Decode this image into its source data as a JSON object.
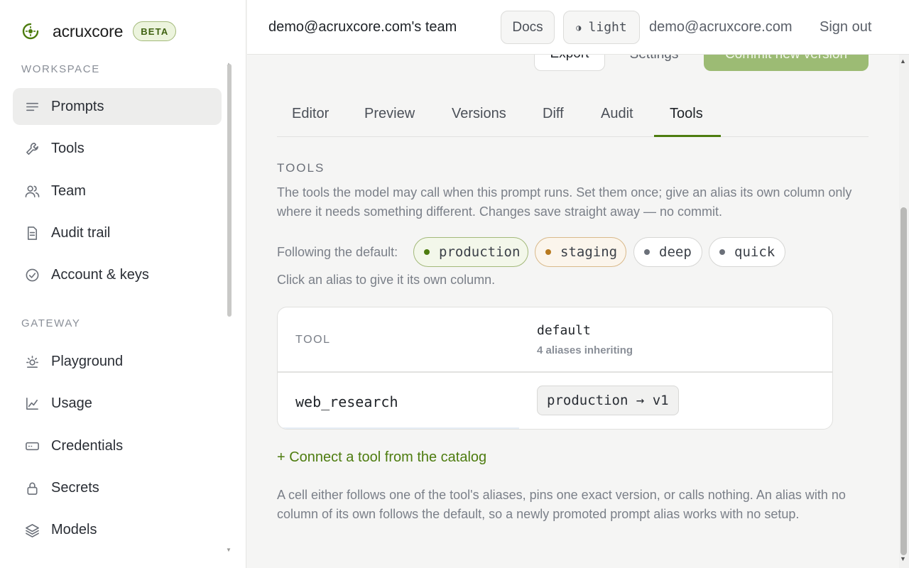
{
  "brand": {
    "name": "acruxcore",
    "badge": "BETA",
    "accent": "#4d7c0f"
  },
  "sidebar": {
    "workspace_label": "WORKSPACE",
    "gateway_label": "GATEWAY",
    "workspace_items": [
      {
        "label": "Prompts",
        "icon": "lines-icon",
        "active": true
      },
      {
        "label": "Tools",
        "icon": "wrench-icon"
      },
      {
        "label": "Team",
        "icon": "users-icon"
      },
      {
        "label": "Audit trail",
        "icon": "document-icon"
      },
      {
        "label": "Account & keys",
        "icon": "check-circle-icon"
      }
    ],
    "gateway_items": [
      {
        "label": "Playground",
        "icon": "sun-icon"
      },
      {
        "label": "Usage",
        "icon": "chart-icon"
      },
      {
        "label": "Credentials",
        "icon": "card-icon"
      },
      {
        "label": "Secrets",
        "icon": "lock-icon"
      },
      {
        "label": "Models",
        "icon": "layers-icon"
      }
    ]
  },
  "topbar": {
    "team": "demo@acruxcore.com's team",
    "docs": "Docs",
    "theme_icon": "◑",
    "theme": "light",
    "email": "demo@acruxcore.com",
    "sign_out": "Sign out"
  },
  "actions": {
    "export": "Export",
    "settings": "Settings",
    "commit": "Commit new version"
  },
  "tabs": [
    "Editor",
    "Preview",
    "Versions",
    "Diff",
    "Audit",
    "Tools"
  ],
  "active_tab": "Tools",
  "tools_section": {
    "heading": "TOOLS",
    "description": "The tools the model may call when this prompt runs. Set them once; give an alias its own column only where it needs something different. Changes save straight away — no commit.",
    "following_label": "Following the default:",
    "aliases": [
      {
        "name": "production",
        "color": "#4d7c0f",
        "border": "#a3b97a",
        "bg": "#f3f7ea"
      },
      {
        "name": "staging",
        "color": "#b7791f",
        "border": "#d9b98a",
        "bg": "#fbf5ec"
      },
      {
        "name": "deep",
        "color": "#6b7079",
        "border": "#d6d6d4",
        "bg": "#ffffff"
      },
      {
        "name": "quick",
        "color": "#6b7079",
        "border": "#d6d6d4",
        "bg": "#ffffff"
      }
    ],
    "hint": "Click an alias to give it its own column.",
    "table": {
      "col_tool": "TOOL",
      "col_default": "default",
      "col_default_sub": "4 aliases inheriting",
      "rows": [
        {
          "tool": "web_research",
          "pin": "production → v1"
        }
      ]
    },
    "connect_link": "+ Connect a tool from the catalog",
    "footnote": "A cell either follows one of the tool's aliases, pins one exact version, or calls nothing. An alias with no column of its own follows the default, so a newly promoted prompt alias works with no setup."
  }
}
